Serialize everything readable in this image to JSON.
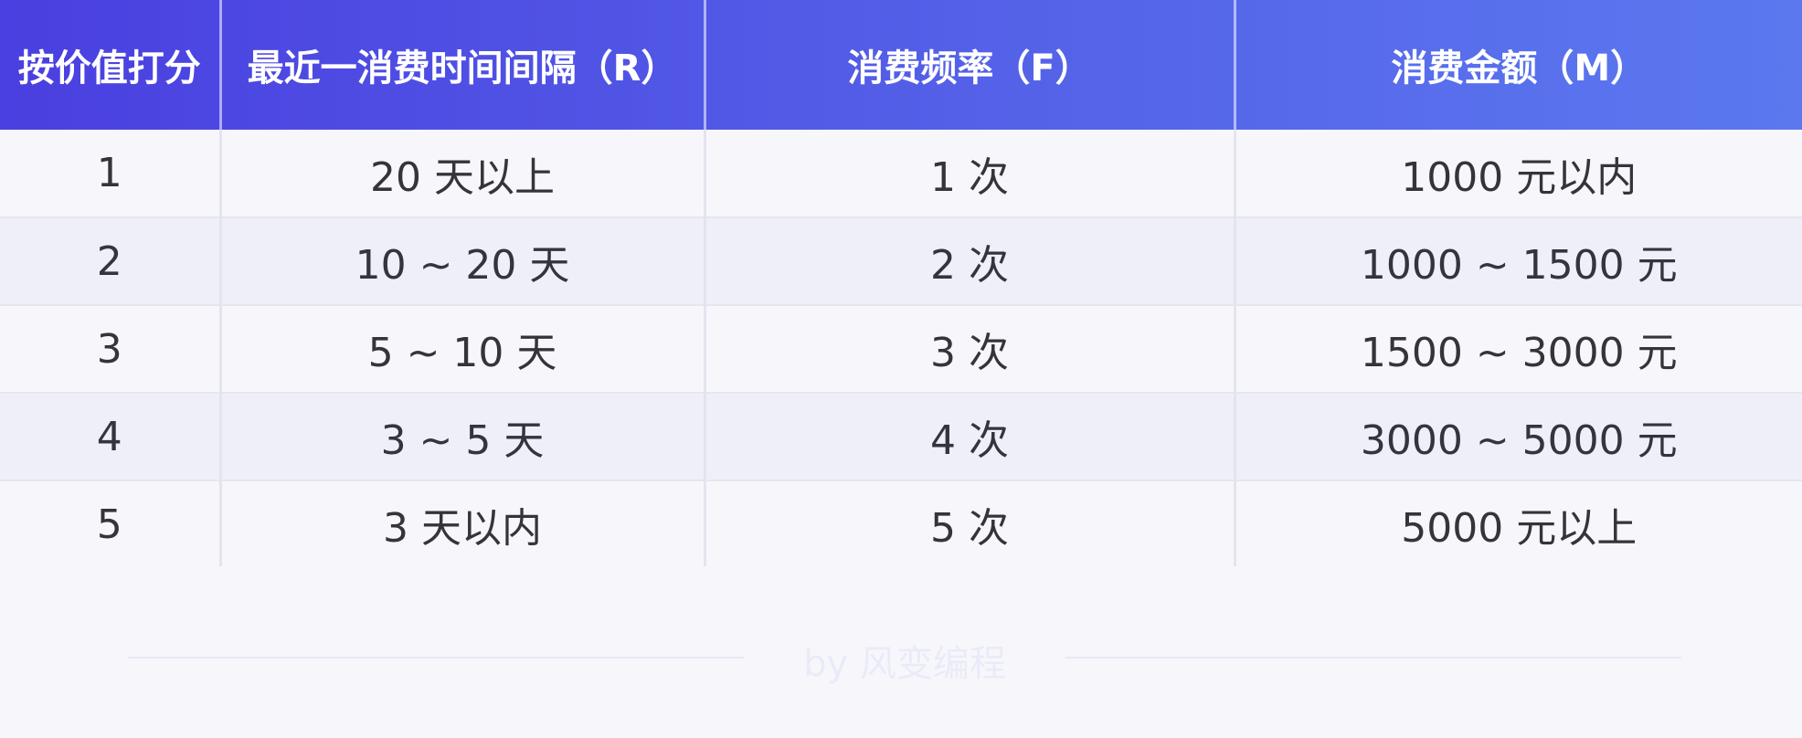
{
  "table": {
    "headers": [
      "按价值打分",
      "最近一消费时间间隔（R）",
      "消费频率（F）",
      "消费金额（M）"
    ],
    "rows": [
      [
        "1",
        "20 天以上",
        "1 次",
        "1000 元以内"
      ],
      [
        "2",
        "10 ~ 20 天",
        "2 次",
        "1000 ~ 1500 元"
      ],
      [
        "3",
        "5 ~ 10 天",
        "3 次",
        "1500 ~ 3000 元"
      ],
      [
        "4",
        "3 ~ 5 天",
        "4 次",
        "3000 ~ 5000 元"
      ],
      [
        "5",
        "3 天以内",
        "5 次",
        "5000 元以上"
      ]
    ]
  },
  "footer": {
    "watermark": "by 风变编程"
  },
  "colors": {
    "header_start": "#4a3fe0",
    "header_end": "#5b78ef",
    "row_odd": "#f7f7fb",
    "row_even": "#efeff9",
    "text": "#34343c"
  }
}
